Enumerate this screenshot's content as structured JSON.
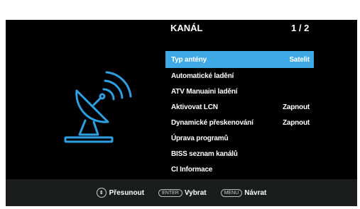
{
  "header": {
    "title": "KANÁL",
    "page": "1 / 2"
  },
  "illustration": {
    "icon": "satellite-dish-icon",
    "stroke": "#2e9fe0"
  },
  "menu": {
    "items": [
      {
        "label": "Typ antény",
        "value": "Satelit",
        "selected": true
      },
      {
        "label": "Automatické ladění",
        "value": ""
      },
      {
        "label": "ATV Manuaini ladění",
        "value": ""
      },
      {
        "label": "Aktivovat LCN",
        "value": "Zapnout"
      },
      {
        "label": "Dynamické přeskenování",
        "value": "Zapnout"
      },
      {
        "label": "Úprava programů",
        "value": ""
      },
      {
        "label": "BISS seznam kanálů",
        "value": ""
      },
      {
        "label": "CI Informace",
        "value": ""
      }
    ],
    "highlight_color": "#3fa9e6"
  },
  "footer": {
    "move_label": "Přesunout",
    "enter_key": "ENTER",
    "select_label": "Vybrat",
    "menu_key": "MENU",
    "back_label": "Návrat"
  }
}
